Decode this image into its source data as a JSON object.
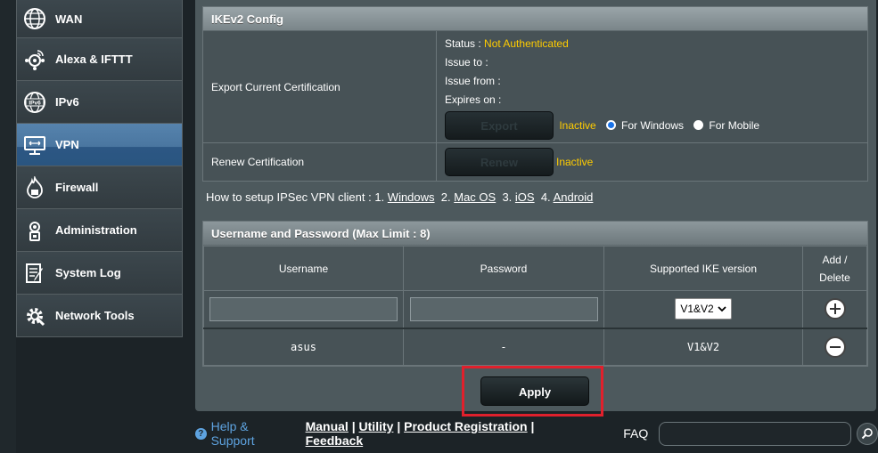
{
  "sidebar": {
    "items": [
      {
        "label": "WAN",
        "icon": "globe-icon"
      },
      {
        "label": "Alexa & IFTTT",
        "icon": "alexa-icon"
      },
      {
        "label": "IPv6",
        "icon": "ipv6-icon"
      },
      {
        "label": "VPN",
        "icon": "vpn-icon",
        "active": true
      },
      {
        "label": "Firewall",
        "icon": "firewall-icon"
      },
      {
        "label": "Administration",
        "icon": "administration-icon"
      },
      {
        "label": "System Log",
        "icon": "system-log-icon"
      },
      {
        "label": "Network Tools",
        "icon": "network-tools-icon"
      }
    ]
  },
  "ikev2": {
    "title": "IKEv2 Config",
    "export_label": "Export Current Certification",
    "status_label": "Status :",
    "status_value": "Not Authenticated",
    "issue_to": "Issue to :",
    "issue_from": "Issue from :",
    "expires_on": "Expires on :",
    "export_button": "Export",
    "export_state": "Inactive",
    "for_windows": "For Windows",
    "for_mobile": "For Mobile",
    "renew_label": "Renew Certification",
    "renew_button": "Renew",
    "renew_state": "Inactive"
  },
  "howto": {
    "text": "How to setup IPSec VPN client :",
    "n1": "1.",
    "l1": "Windows",
    "n2": "2.",
    "l2": "Mac OS",
    "n3": "3.",
    "l3": "iOS",
    "n4": "4.",
    "l4": "Android"
  },
  "users": {
    "title": "Username and Password (Max Limit : 8)",
    "col_username": "Username",
    "col_password": "Password",
    "col_ike": "Supported IKE version",
    "col_add1": "Add /",
    "col_add2": "Delete",
    "select_value": "V1&V2",
    "rows": [
      {
        "username": "asus",
        "password": "-",
        "ike": "V1&V2"
      }
    ]
  },
  "apply_label": "Apply",
  "footer": {
    "help": "Help & Support",
    "manual": "Manual",
    "utility": "Utility",
    "product_registration": "Product Registration",
    "feedback": "Feedback",
    "sep": "|",
    "faq": "FAQ"
  },
  "colors": {
    "accent_warn": "#ffcc00",
    "highlight": "#e0202c",
    "help": "#5ea3e0"
  }
}
